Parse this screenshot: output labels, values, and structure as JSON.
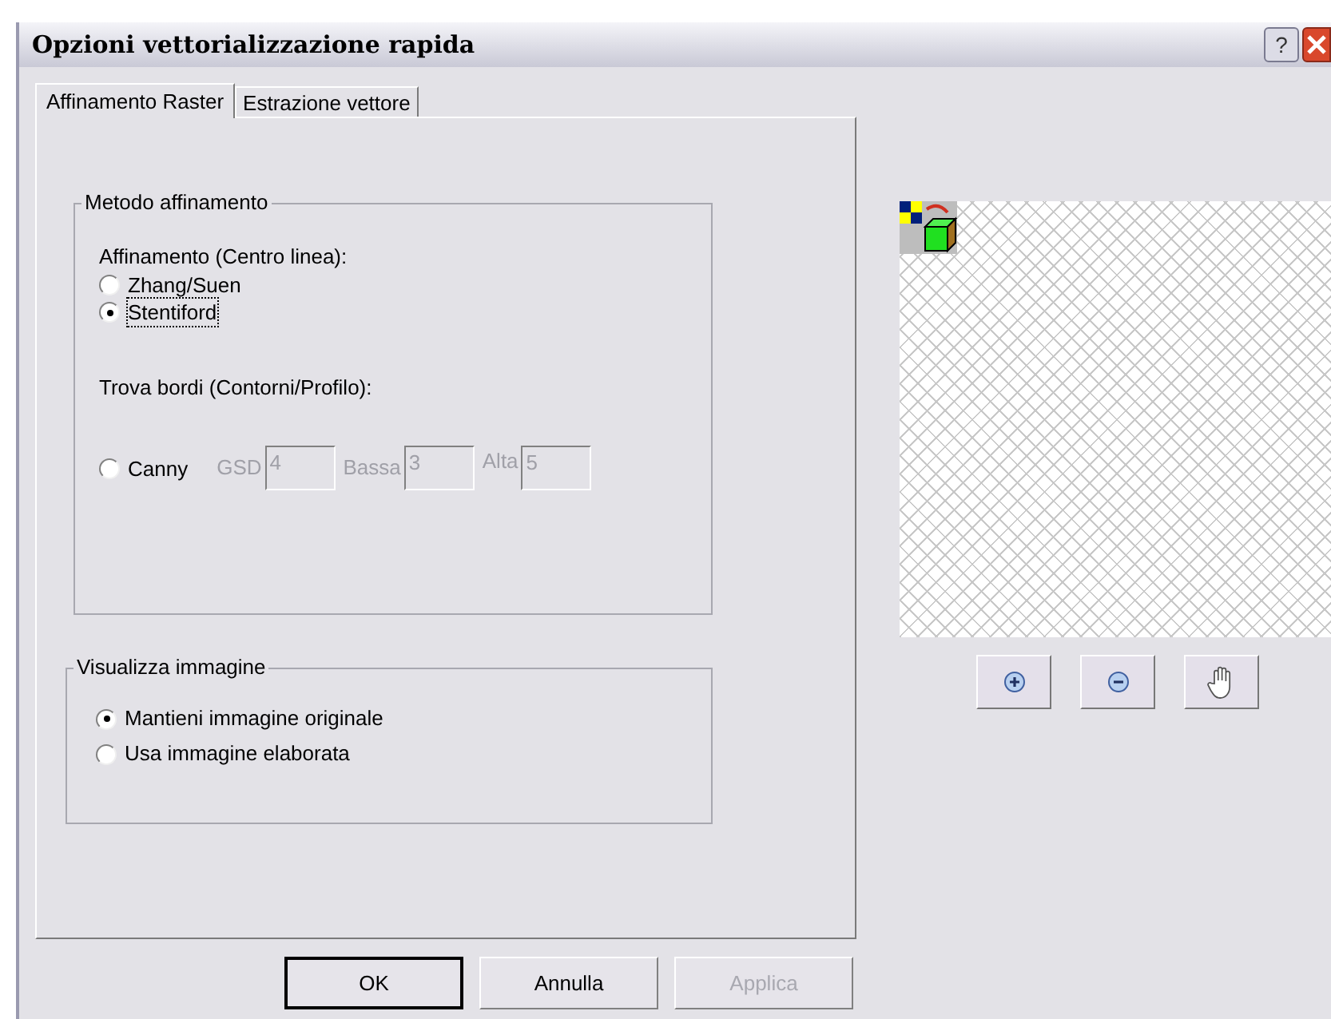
{
  "window": {
    "title": "Opzioni vettorializzazione rapida",
    "help": "?"
  },
  "tabs": [
    {
      "label": "Affinamento Raster",
      "selected": true
    },
    {
      "label": "Estrazione vettore",
      "selected": false
    }
  ],
  "method_group": {
    "title": "Metodo affinamento",
    "thinning_label": "Affinamento (Centro linea):",
    "thinning_options": [
      {
        "label": "Zhang/Suen",
        "selected": false,
        "focused": false
      },
      {
        "label": "Stentiford",
        "selected": true,
        "focused": true
      }
    ],
    "edges_label": "Trova bordi (Contorni/Profilo):",
    "canny": {
      "label": "Canny",
      "selected": false
    },
    "canny_fields": [
      {
        "label": "GSD",
        "value": "4",
        "disabled": true
      },
      {
        "label": "Bassa",
        "value": "3",
        "disabled": true
      },
      {
        "label": "Alta",
        "value": "5",
        "disabled": true
      }
    ]
  },
  "display_group": {
    "title": "Visualizza immagine",
    "options": [
      {
        "label": "Mantieni immagine originale",
        "selected": true
      },
      {
        "label": "Usa immagine elaborata",
        "selected": false
      }
    ]
  },
  "buttons": [
    {
      "label": "OK",
      "default": true,
      "disabled": false
    },
    {
      "label": "Annulla",
      "default": false,
      "disabled": false
    },
    {
      "label": "Applica",
      "default": false,
      "disabled": true
    }
  ]
}
